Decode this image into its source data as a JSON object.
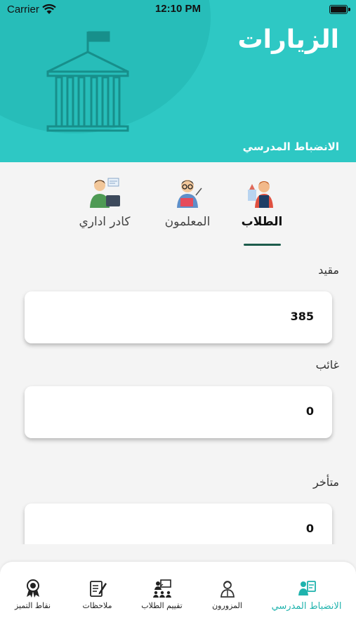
{
  "status_bar": {
    "carrier": "Carrier",
    "time": "12:10 PM"
  },
  "header": {
    "title": "الزيارات",
    "subtitle": "الانضباط المدرسي",
    "icon": "school-building-icon"
  },
  "tabs": [
    {
      "label": "الطلاب",
      "icon": "student-avatar-icon",
      "active": true
    },
    {
      "label": "المعلمون",
      "icon": "teacher-avatar-icon",
      "active": false
    },
    {
      "label": "كادر اداري",
      "icon": "admin-staff-avatar-icon",
      "active": false
    }
  ],
  "fields": {
    "present": {
      "label": "مقيد",
      "value": "385"
    },
    "absent": {
      "label": "غائب",
      "value": "0"
    },
    "late": {
      "label": "متأخر",
      "value": "0"
    }
  },
  "bottom_nav": [
    {
      "label": "الانضباط المدرسي",
      "icon": "discipline-icon",
      "active": true
    },
    {
      "label": "المزورون",
      "icon": "visitors-icon",
      "active": false
    },
    {
      "label": "تقييم الطلاب",
      "icon": "student-evaluation-icon",
      "active": false
    },
    {
      "label": "ملاحظات",
      "icon": "notes-icon",
      "active": false
    },
    {
      "label": "نقاط التميز",
      "icon": "excellence-badge-icon",
      "active": false
    }
  ],
  "colors": {
    "header": "#2ec8c4",
    "accent": "#1fb3ad",
    "underline": "#1d5c4c",
    "background": "#f4f4f4"
  }
}
